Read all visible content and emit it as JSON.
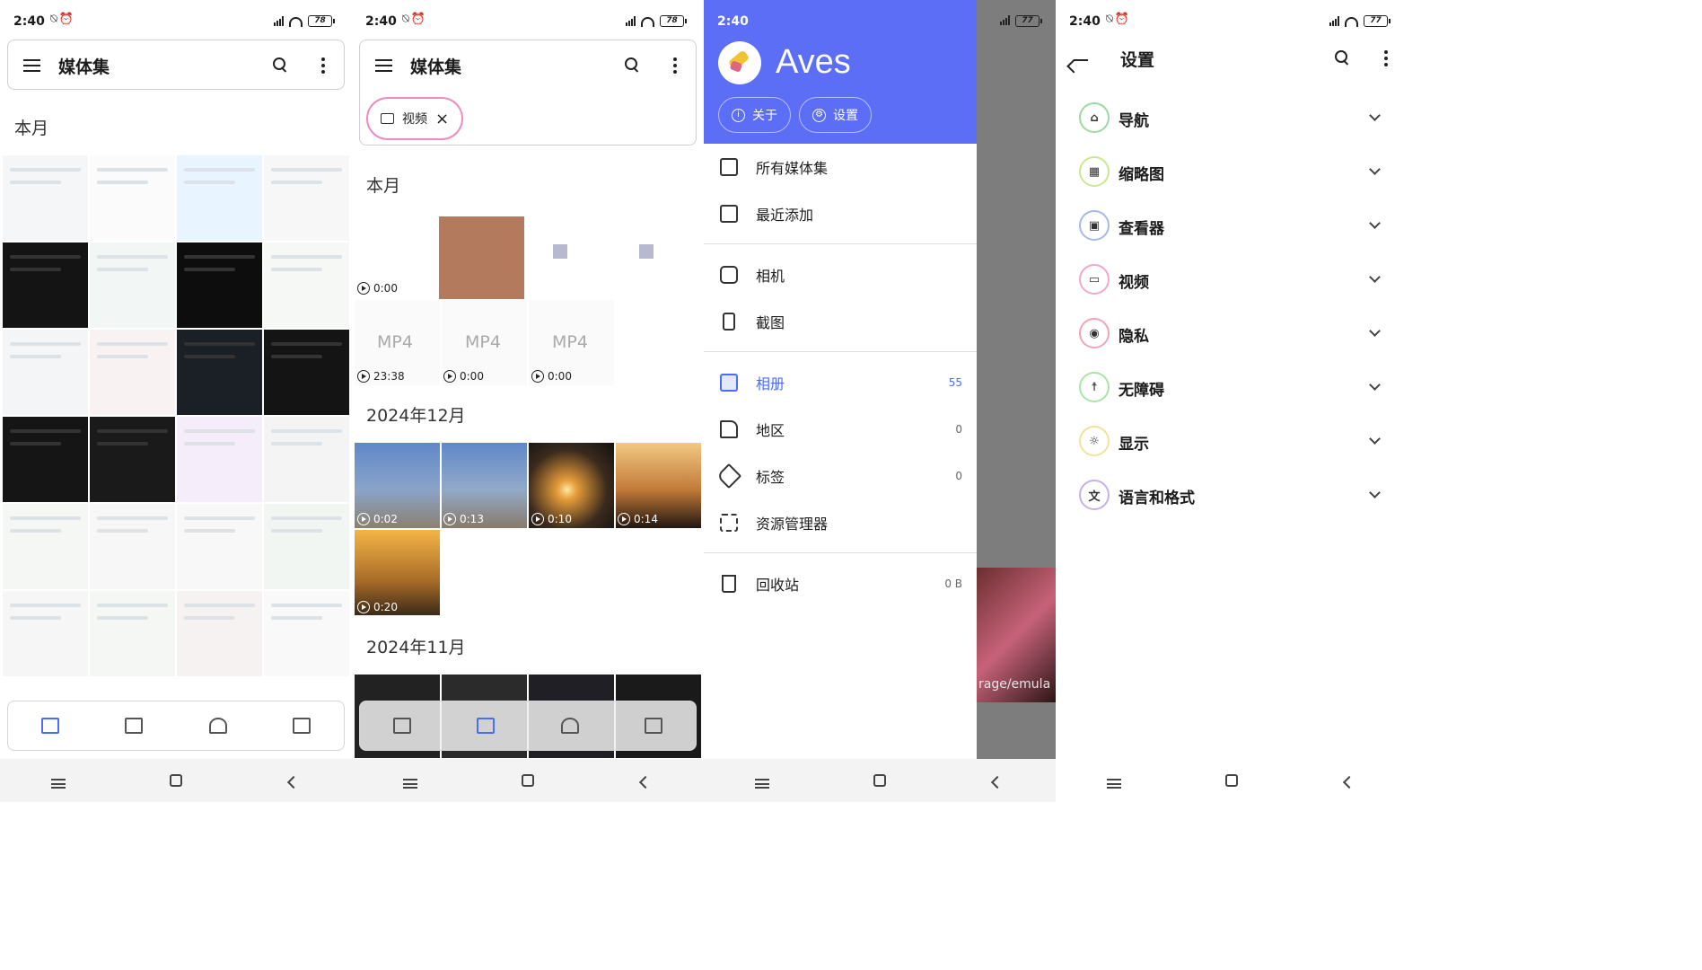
{
  "status": {
    "time": "2:40",
    "battery_p1": "78",
    "battery_p2": "78",
    "battery_p3": "77",
    "battery_p4": "77"
  },
  "panel1": {
    "title": "媒体集",
    "section": "本月"
  },
  "panel2": {
    "title": "媒体集",
    "chip_label": "视频",
    "sections": [
      "本月",
      "2024年12月",
      "2024年11月"
    ],
    "mp4_label": "MP4",
    "durations_this_month": [
      "0:00",
      "23:38",
      "0:00",
      "0:00"
    ],
    "durations_dec": [
      "0:02",
      "0:13",
      "0:10",
      "0:14",
      "0:20"
    ]
  },
  "drawer": {
    "app_name": "Aves",
    "about_label": "关于",
    "settings_label": "设置",
    "items": [
      {
        "label": "所有媒体集",
        "count": ""
      },
      {
        "label": "最近添加",
        "count": ""
      },
      {
        "label": "相机",
        "count": ""
      },
      {
        "label": "截图",
        "count": ""
      },
      {
        "label": "相册",
        "count": "55"
      },
      {
        "label": "地区",
        "count": "0"
      },
      {
        "label": "标签",
        "count": "0"
      },
      {
        "label": "资源管理器",
        "count": ""
      },
      {
        "label": "回收站",
        "count": "0 B"
      }
    ],
    "background_text": "rage/emula"
  },
  "settings": {
    "title": "设置",
    "rows": [
      {
        "label": "导航",
        "icon": "home-icon",
        "color": "#9ad9a0"
      },
      {
        "label": "缩略图",
        "icon": "grid-icon",
        "color": "#c9e88f"
      },
      {
        "label": "查看器",
        "icon": "image-icon",
        "color": "#a6b8ee"
      },
      {
        "label": "视频",
        "icon": "movie-icon",
        "color": "#f2a6cf"
      },
      {
        "label": "隐私",
        "icon": "shield-icon",
        "color": "#f4a3b5"
      },
      {
        "label": "无障碍",
        "icon": "accessibility-icon",
        "color": "#a8e6a3"
      },
      {
        "label": "显示",
        "icon": "sun-icon",
        "color": "#f2e39a"
      },
      {
        "label": "语言和格式",
        "icon": "translate-icon",
        "color": "#c5b0ea"
      }
    ]
  },
  "colors": {
    "accent": "#4a6cf7",
    "drawer_header": "#5b6ef5"
  }
}
